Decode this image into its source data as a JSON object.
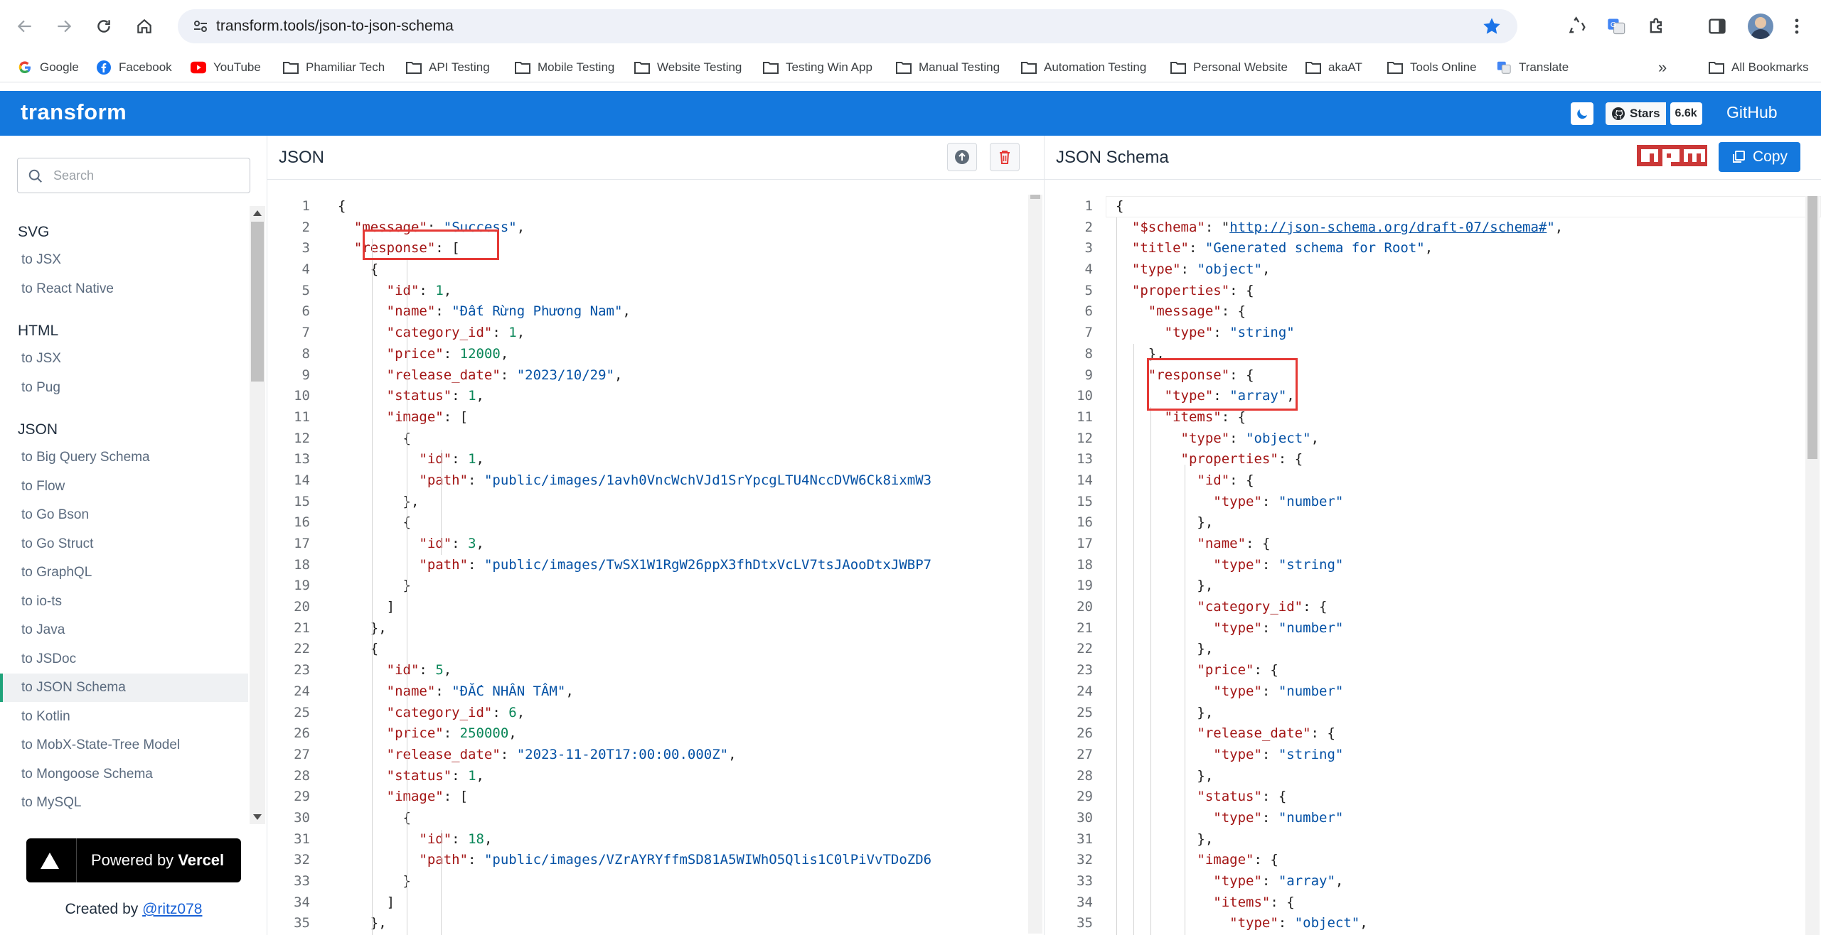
{
  "browser": {
    "url": "transform.tools/json-to-json-schema",
    "bookmarks": [
      "Google",
      "Facebook",
      "YouTube",
      "Phamiliar Tech",
      "API Testing",
      "Mobile Testing",
      "Website Testing",
      "Testing Win App",
      "Manual Testing",
      "Automation Testing",
      "Personal Website",
      "akaAT",
      "Tools Online",
      "Translate"
    ],
    "all_bookmarks": "All Bookmarks"
  },
  "app": {
    "brand": "transform",
    "stars_label": "Stars",
    "stars_count": "6.6k",
    "github": "GitHub"
  },
  "sidebar": {
    "search_placeholder": "Search",
    "groups": [
      {
        "title": "SVG",
        "items": [
          "to JSX",
          "to React Native"
        ]
      },
      {
        "title": "HTML",
        "items": [
          "to JSX",
          "to Pug"
        ]
      },
      {
        "title": "JSON",
        "items": [
          "to Big Query Schema",
          "to Flow",
          "to Go Bson",
          "to Go Struct",
          "to GraphQL",
          "to io-ts",
          "to Java",
          "to JSDoc",
          "to JSON Schema",
          "to Kotlin",
          "to MobX-State-Tree Model",
          "to Mongoose Schema",
          "to MySQL"
        ]
      }
    ],
    "active_item": "to JSON Schema",
    "powered_by": "Powered by",
    "vercel": "Vercel",
    "created_by": "Created by",
    "author": "@ritz078"
  },
  "left_panel": {
    "title": "JSON",
    "lines": [
      "{",
      "  \"message\": \"Success\",",
      "  \"response\": [",
      "    {",
      "      \"id\": 1,",
      "      \"name\": \"Đất Rừng Phương Nam\",",
      "      \"category_id\": 1,",
      "      \"price\": 12000,",
      "      \"release_date\": \"2023/10/29\",",
      "      \"status\": 1,",
      "      \"image\": [",
      "        {",
      "          \"id\": 1,",
      "          \"path\": \"public/images/1avh0VncWchVJd1SrYpcgLTU4NccDVW6Ck8ixmW3",
      "        },",
      "        {",
      "          \"id\": 3,",
      "          \"path\": \"public/images/TwSX1W1RgW26ppX3fhDtxVcLV7tsJAooDtxJWBP7",
      "        }",
      "      ]",
      "    },",
      "    {",
      "      \"id\": 5,",
      "      \"name\": \"ĐẮC NHÂN TÂM\",",
      "      \"category_id\": 6,",
      "      \"price\": 250000,",
      "      \"release_date\": \"2023-11-20T17:00:00.000Z\",",
      "      \"status\": 1,",
      "      \"image\": [",
      "        {",
      "          \"id\": 18,",
      "          \"path\": \"public/images/VZrAYRYffmSD81A5WIWhO5Qlis1C0lPiVvTDoZD6",
      "        }",
      "      ]",
      "    },"
    ]
  },
  "right_panel": {
    "title": "JSON Schema",
    "npm": "npm",
    "copy_label": "Copy",
    "lines": [
      "{",
      "  \"$schema\": \"http://json-schema.org/draft-07/schema#\",",
      "  \"title\": \"Generated schema for Root\",",
      "  \"type\": \"object\",",
      "  \"properties\": {",
      "    \"message\": {",
      "      \"type\": \"string\"",
      "    },",
      "    \"response\": {",
      "      \"type\": \"array\",",
      "      \"items\": {",
      "        \"type\": \"object\",",
      "        \"properties\": {",
      "          \"id\": {",
      "            \"type\": \"number\"",
      "          },",
      "          \"name\": {",
      "            \"type\": \"string\"",
      "          },",
      "          \"category_id\": {",
      "            \"type\": \"number\"",
      "          },",
      "          \"price\": {",
      "            \"type\": \"number\"",
      "          },",
      "          \"release_date\": {",
      "            \"type\": \"string\"",
      "          },",
      "          \"status\": {",
      "            \"type\": \"number\"",
      "          },",
      "          \"image\": {",
      "            \"type\": \"array\",",
      "            \"items\": {",
      "              \"type\": \"object\","
    ]
  },
  "colors": {
    "header": "#1478dd",
    "key": "#a31515",
    "string": "#0451a5",
    "number": "#098658",
    "highlight": "#e53935",
    "active_border": "#1fa37a"
  }
}
